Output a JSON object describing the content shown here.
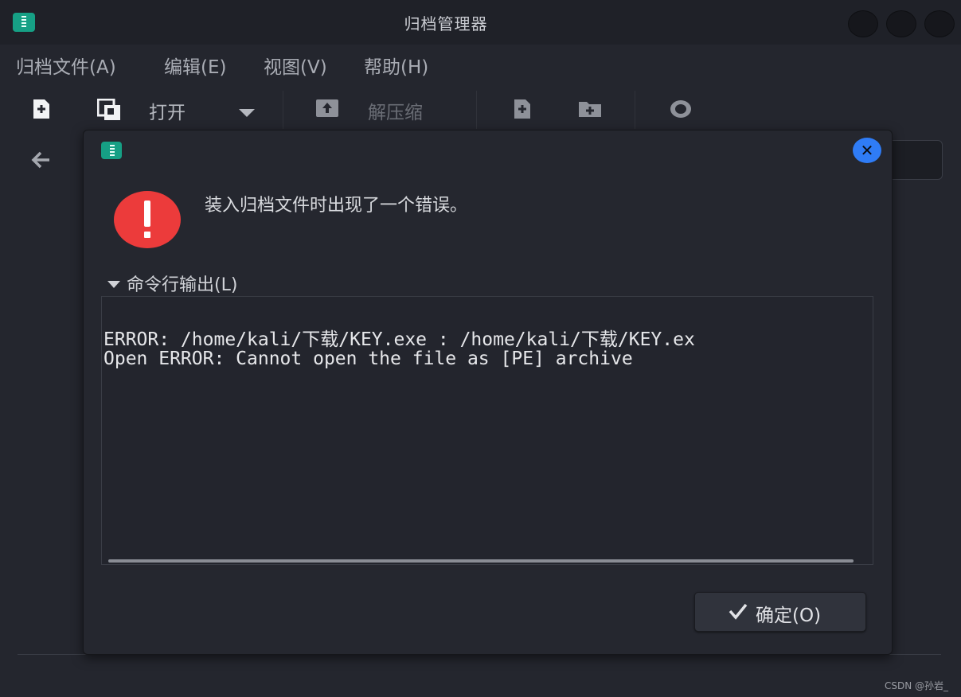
{
  "window": {
    "title": "归档管理器",
    "app_icon": "archive-icon"
  },
  "menu": [
    "归档文件(A)",
    "编辑(E)",
    "视图(V)",
    "帮助(H)"
  ],
  "toolbar": {
    "new_icon": "new-archive-icon",
    "open_icon": "open-archive-icon",
    "open_label": "打开",
    "open_dropdown_icon": "chevron-down-icon",
    "extract_icon": "extract-icon",
    "extract_label": "解压缩",
    "add_files_icon": "add-files-icon",
    "add_folder_icon": "add-folder-icon",
    "stop_icon": "stop-icon"
  },
  "dialog": {
    "app_icon": "archive-icon",
    "close_icon": "close-icon",
    "status_icon": "error-icon",
    "message": "装入归档文件时出现了一个错误。",
    "expander_label": "命令行输出(L)",
    "output_lines": [
      "ERROR: /home/kali/下载/KEY.exe : /home/kali/下载/KEY.ex",
      "Open ERROR: Cannot open the file as [PE] archive"
    ],
    "ok_label": "确定(O)",
    "ok_icon": "check-icon"
  },
  "watermark": "CSDN @孙岩_",
  "colors": {
    "error": "#ec3b3b",
    "close_accent": "#2f7cf6",
    "app_icon": "#16a085"
  }
}
